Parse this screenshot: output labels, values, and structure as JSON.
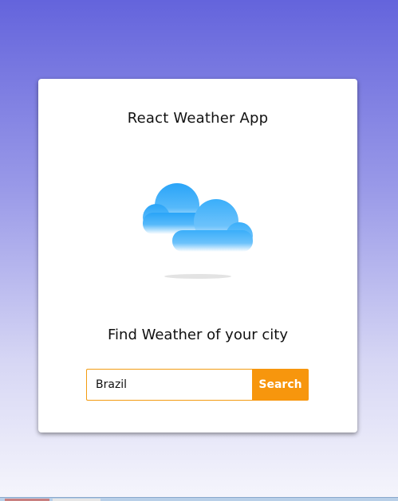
{
  "app": {
    "title": "React Weather App"
  },
  "illustration": {
    "icon": "cloudy-weather-icon",
    "colors": {
      "cloud_top": "#2aa4f8",
      "cloud_bottom": "#ffffff",
      "shadow": "#e3e3e3"
    }
  },
  "search": {
    "heading": "Find Weather of your city",
    "input_value": "Brazil",
    "button_label": "Search"
  },
  "colors": {
    "accent": "#f7960d",
    "background_top": "#6464dc",
    "background_bottom": "#f6f6fc"
  }
}
